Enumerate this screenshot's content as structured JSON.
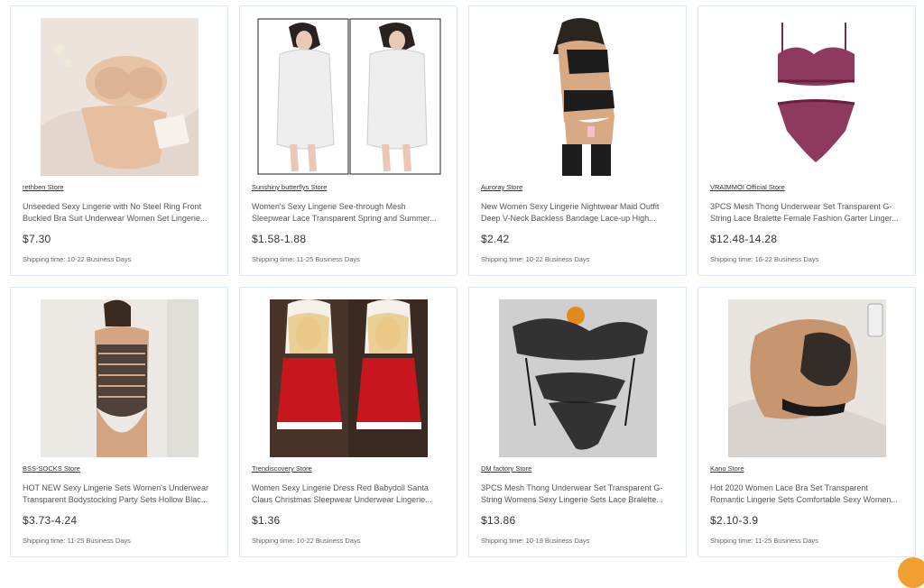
{
  "products": [
    {
      "store": "rethben Store",
      "title": "Unseeded Sexy Lingerie with No Steel Ring Front Buckled Bra Suit Underwear Women Set Lingerie...",
      "price": "$7.30",
      "shipping": "Shipping time: 10-22 Business Days",
      "image_icon": "beige-bra-set-photo"
    },
    {
      "store": "Sunshiny butterflys Store",
      "title": "Women's Sexy Lingerie See-through Mesh Sleepwear Lace Transparent Spring and Summer...",
      "price": "$1.58-1.88",
      "shipping": "Shipping time: 11-25 Business Days",
      "image_icon": "white-lace-robe-photo"
    },
    {
      "store": "Auroray Store",
      "title": "New Women Sexy Lingerie Nightwear Maid Outfit Deep V-Neck Backless Bandage Lace-up High...",
      "price": "$2.42",
      "shipping": "Shipping time: 10-22 Business Days",
      "image_icon": "black-lingerie-photo"
    },
    {
      "store": "VRAIMMOI Official Store",
      "title": "3PCS Mesh Thong Underwear Set Transparent G-String Lace Bralette Female Fashion Garter Linger...",
      "price": "$12.48-14.28",
      "shipping": "Shipping time: 16-22 Business Days",
      "image_icon": "purple-mesh-set-photo"
    },
    {
      "store": "BSS-SOCKS Store",
      "title": "HOT NEW Sexy Lingerie Sets Women's Underwear Transparent Bodystocking Party Sets Hollow Blac...",
      "price": "$3.73-4.24",
      "shipping": "Shipping time: 11-25 Business Days",
      "image_icon": "black-bodystocking-photo"
    },
    {
      "store": "Trendiscovery Store",
      "title": "Women Sexy Lingerie Dress Red Babydoll Santa Claus Christmas Sleepwear Underwear Lingerie...",
      "price": "$1.36",
      "shipping": "Shipping time: 10-22 Business Days",
      "image_icon": "red-santa-dress-photo"
    },
    {
      "store": "DM factory Store",
      "title": "3PCS Mesh Thong Underwear Set Transparent G-String Womens Sexy Lingerie Sets Lace Bralette...",
      "price": "$13.86",
      "shipping": "Shipping time: 10-19 Business Days",
      "image_icon": "black-mesh-set-photo"
    },
    {
      "store": "Kano Store",
      "title": "Hot 2020 Women Lace Bra Set Transparent Romantic Lingerie Sets Comfortable Sexy Women...",
      "price": "$2.10-3.9",
      "shipping": "Shipping time: 11-25 Business Days",
      "image_icon": "black-lace-bra-photo"
    }
  ],
  "colors": {
    "card_border": "#dbe6f3",
    "price_text": "#333333",
    "fab": "#f0a030"
  }
}
